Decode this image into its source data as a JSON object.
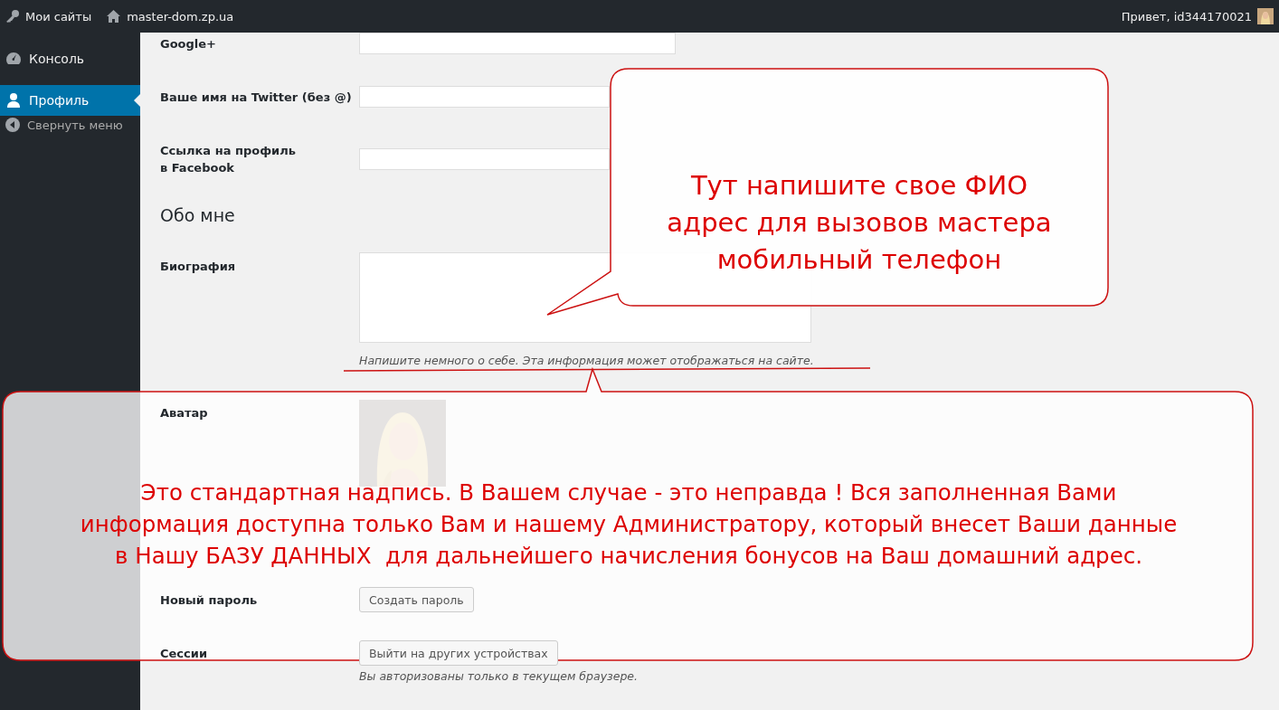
{
  "admin_bar": {
    "my_sites": "Мои сайты",
    "site": "master-dom.zp.ua",
    "greeting": "Привет, id344170021"
  },
  "sidebar": {
    "items": [
      {
        "label": "Консоль",
        "selected": false
      },
      {
        "label": "Профиль",
        "selected": true
      }
    ],
    "collapse": "Свернуть меню"
  },
  "fields": [
    {
      "label": "Google+"
    },
    {
      "label": "Ваше имя на Twitter (без @)"
    },
    {
      "label": "Ссылка на профиль в Facebook"
    }
  ],
  "about": {
    "heading": "Обо мне",
    "bio_label": "Биография",
    "bio_description": "Напишите немного о себе. Эта информация может отображаться на сайте."
  },
  "avatar": {
    "label": "Аватар"
  },
  "account": [
    {
      "label": "Новый пароль",
      "button": "Создать пароль"
    },
    {
      "label": "Сессии",
      "button": "Выйти на других устройствах",
      "note": "Вы авторизованы только в текущем браузере."
    }
  ],
  "callouts": [
    {
      "lines": [
        "Тут напишите свое ФИО",
        "адрес для вызовов мастера",
        "мобильный телефон"
      ]
    },
    {
      "lines": [
        "Это стандартная надпись. В Вашем случае - это неправда ! Вся заполненная Вами",
        "информация доступна только Вам и нашему Администратору, который внесет Ваши данные",
        "в Нашу БАЗУ ДАННЫХ  для дальнейшего начисления бонусов на Ваш домашний адрес."
      ]
    }
  ]
}
